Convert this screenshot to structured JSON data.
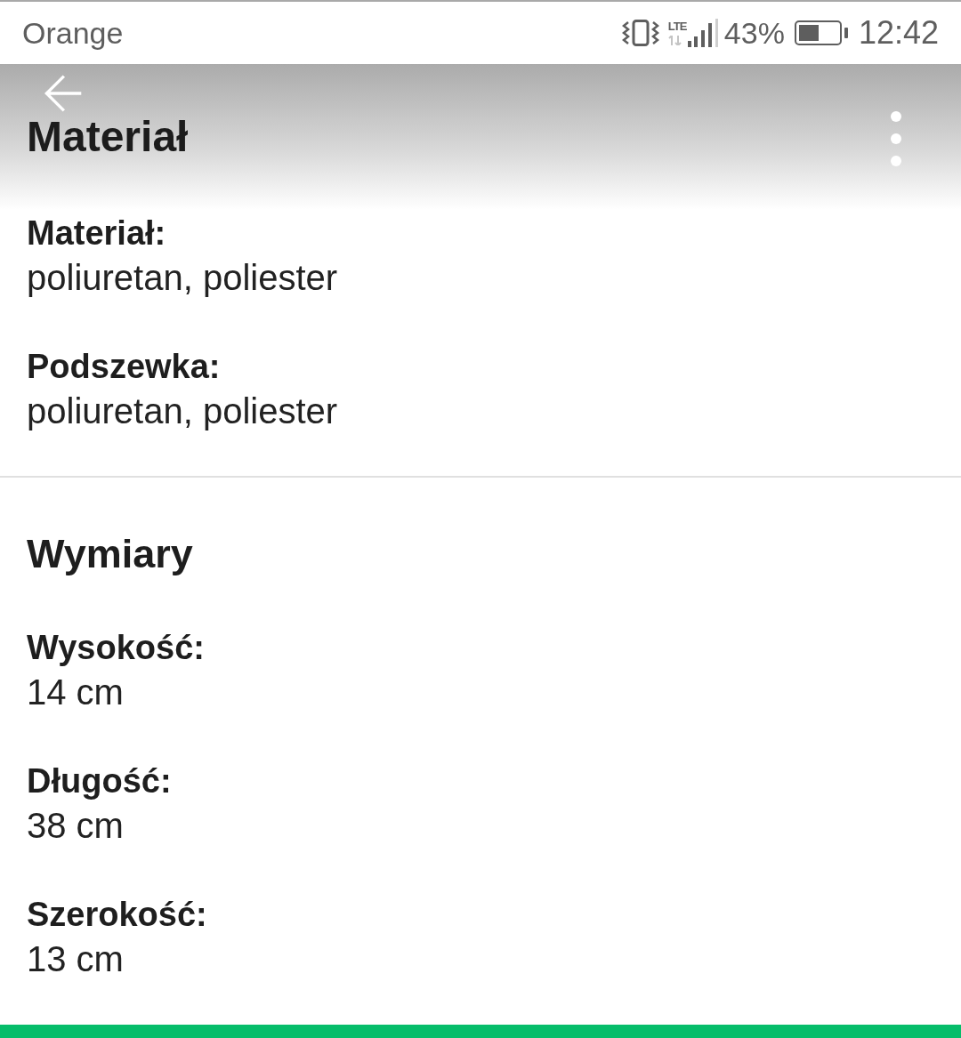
{
  "status_bar": {
    "carrier": "Orange",
    "network": "LTE",
    "battery_text": "43%",
    "time": "12:42"
  },
  "app_bar": {
    "title": "Materiał"
  },
  "sections": [
    {
      "fields": [
        {
          "label": "Materiał:",
          "value": "poliuretan, poliester"
        },
        {
          "label": "Podszewka:",
          "value": "poliuretan, poliester"
        }
      ]
    },
    {
      "heading": "Wymiary",
      "fields": [
        {
          "label": "Wysokość:",
          "value": "14 cm"
        },
        {
          "label": "Długość:",
          "value": "38 cm"
        },
        {
          "label": "Szerokość:",
          "value": "13 cm"
        }
      ]
    }
  ]
}
